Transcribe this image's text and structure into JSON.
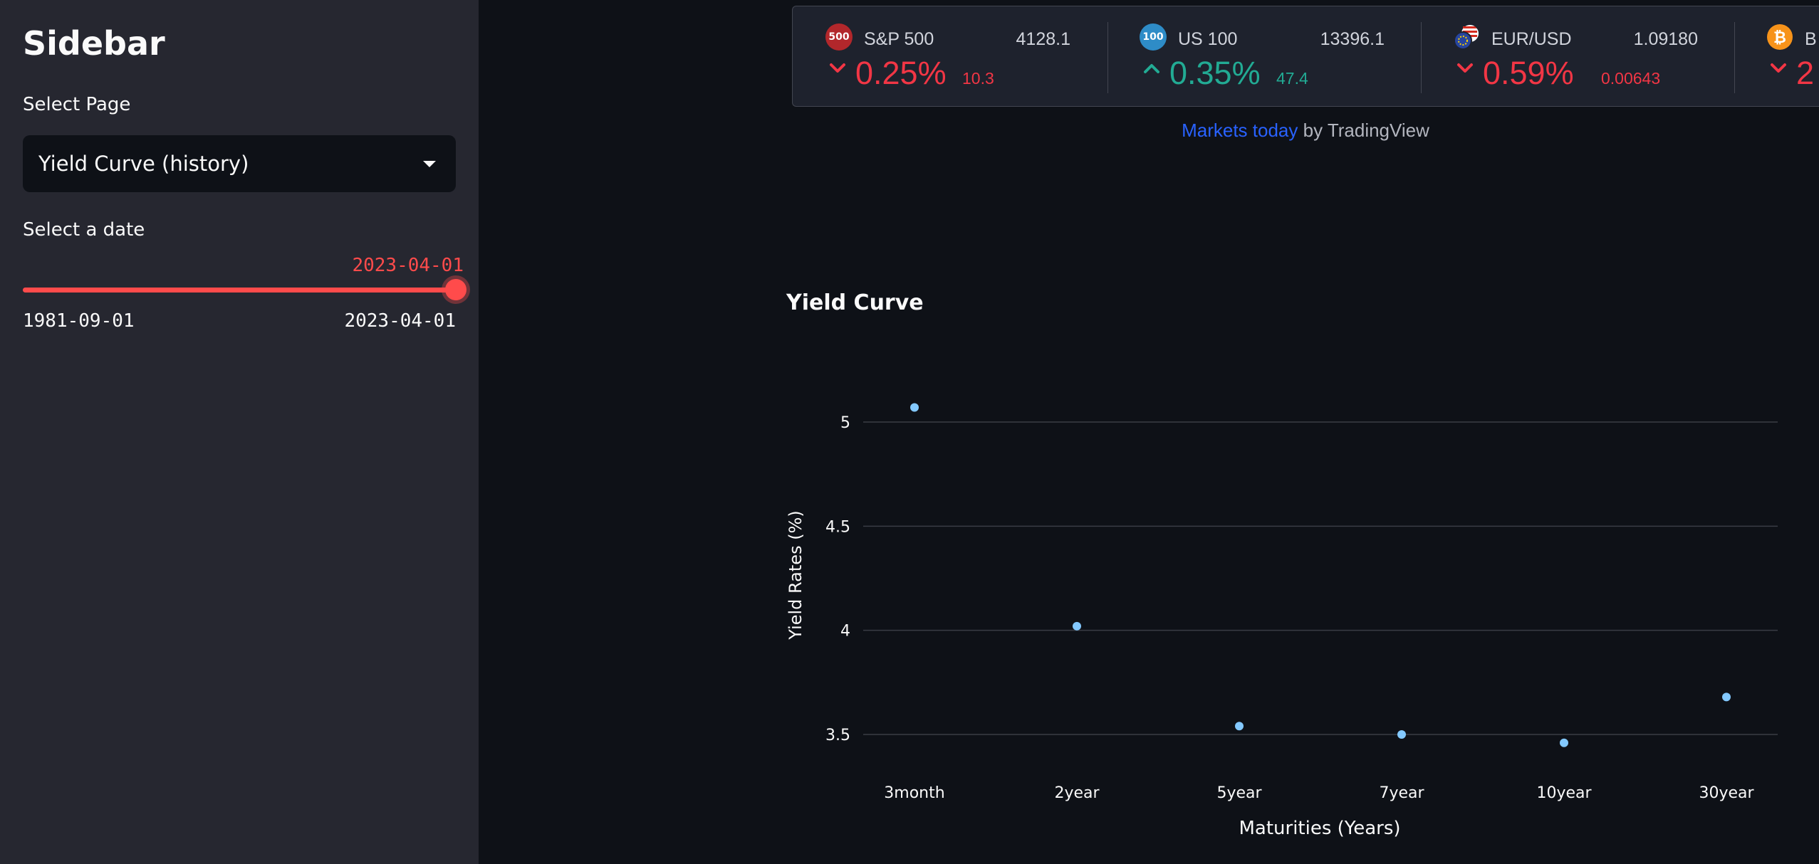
{
  "sidebar": {
    "title": "Sidebar",
    "select_page_label": "Select Page",
    "select_page_value": "Yield Curve (history)",
    "date_label": "Select a date",
    "slider": {
      "value": "2023-04-01",
      "min": "1981-09-01",
      "max": "2023-04-01",
      "fraction": 1.0
    }
  },
  "ticker": {
    "items": [
      {
        "logo": "500",
        "logo_color": "#b2272b",
        "name": "S&P 500",
        "price": "4128.1",
        "pct": "0.25%",
        "change": "10.3",
        "direction": "down"
      },
      {
        "logo": "100",
        "logo_color": "#2e8cc7",
        "name": "US 100",
        "price": "13396.1",
        "pct": "0.35%",
        "change": "47.4",
        "direction": "up"
      },
      {
        "logo": "flag",
        "logo_color": "#27459f",
        "name": "EUR/USD",
        "price": "1.09180",
        "pct": "0.59%",
        "change": "0.00643",
        "direction": "down"
      },
      {
        "logo": "bitcoin",
        "logo_color": "#f7931a",
        "name": "B",
        "price": "",
        "pct": "2",
        "change": "",
        "direction": "down"
      }
    ],
    "attribution_link": "Markets today",
    "attribution_text": " by TradingView"
  },
  "colors": {
    "accent": "#ff4b4b",
    "negative": "#f23645",
    "positive": "#22ab94",
    "point": "#83c9ff",
    "link": "#2962ff"
  },
  "chart_data": {
    "type": "scatter",
    "title": "Yield Curve",
    "xlabel": "Maturities (Years)",
    "ylabel": "Yield Rates (%)",
    "categories": [
      "3month",
      "2year",
      "5year",
      "7year",
      "10year",
      "30year"
    ],
    "values": [
      5.07,
      4.02,
      3.54,
      3.5,
      3.46,
      3.68
    ],
    "yticks": [
      3.5,
      4,
      4.5,
      5
    ],
    "ytick_labels": [
      "3.5",
      "4",
      "4.5",
      "5"
    ],
    "ylim": [
      3.33,
      5.18
    ],
    "grid": true
  }
}
